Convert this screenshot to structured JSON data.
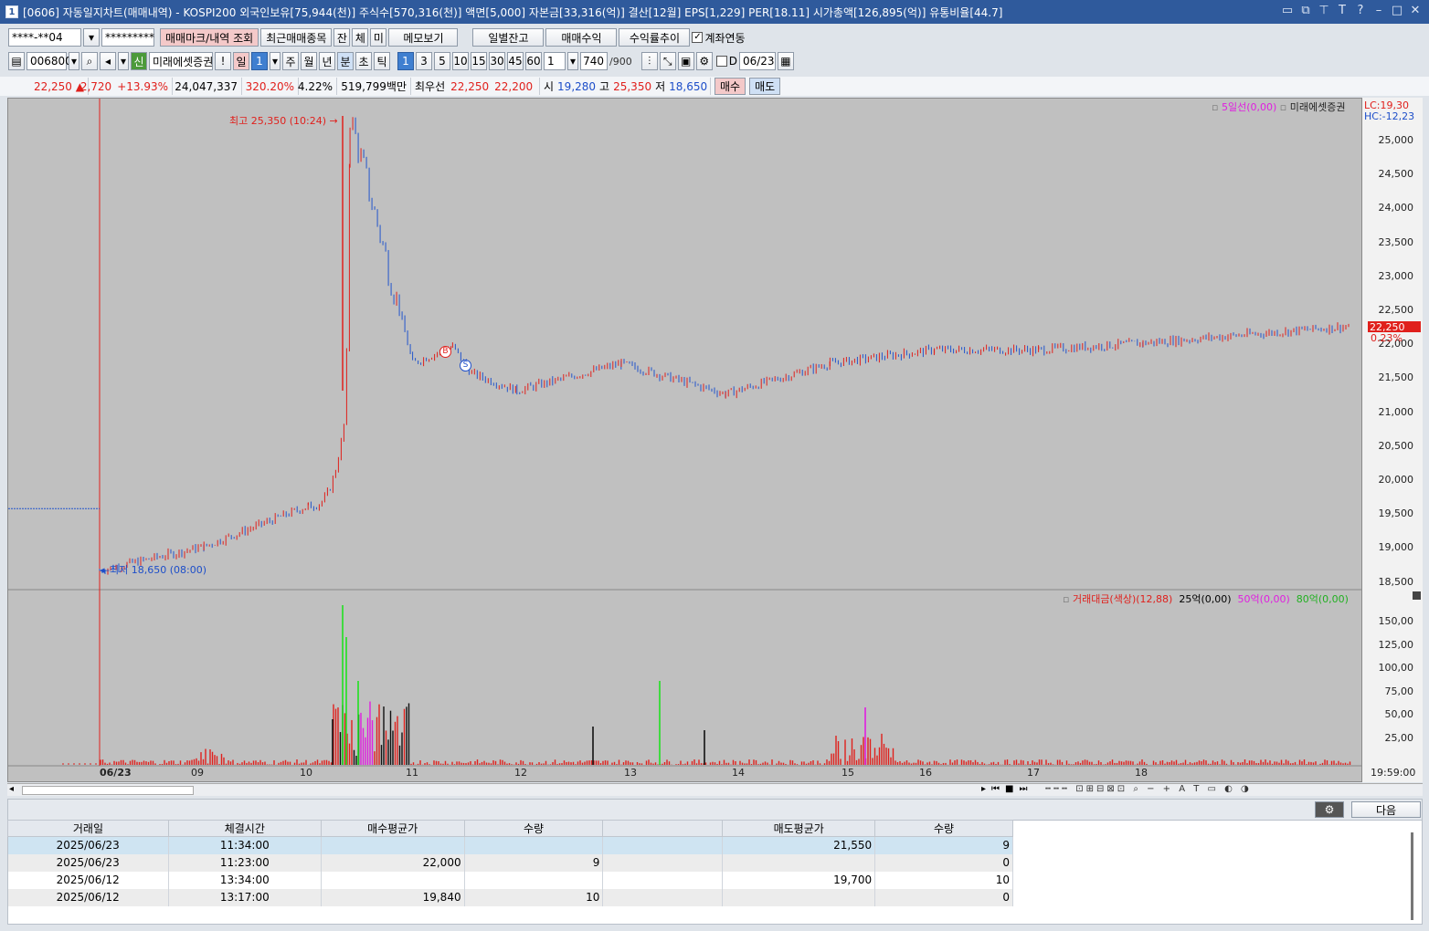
{
  "title": {
    "window_no": "1",
    "text": "[0606] 자동일지차트(매매내역) - KOSPI200 외국인보유[75,944(천)] 주식수[570,316(천)] 액면[5,000] 자본금[33,316(억)] 결산[12월] EPS[1,229] PER[18.11] 시가총액[126,895(억)] 유통비율[44.7]"
  },
  "toolbar1": {
    "account": "****-**04",
    "password": "*********",
    "mark_btn": "매매마크/내역 조회",
    "recent_btn": "최근매매종목",
    "tab_jan": "잔",
    "tab_che": "체",
    "tab_mi": "미",
    "memo_btn": "메모보기",
    "daily_btn": "일별잔고",
    "profit_btn": "매매수익",
    "yield_btn": "수익률추이",
    "link_check": "계좌연동"
  },
  "toolbar2": {
    "code": "006800",
    "badge": "신",
    "name": "미래에셋증권",
    "excl": "!",
    "periods": [
      "일",
      "1",
      "주",
      "월",
      "년",
      "분",
      "초",
      "틱"
    ],
    "minutes": [
      "1",
      "3",
      "5",
      "10",
      "15",
      "30",
      "45",
      "60"
    ],
    "unit": "1",
    "count": "740",
    "count_max": "/900",
    "d_label": "D",
    "date": "06/23"
  },
  "quote": {
    "price": "22,250",
    "arrow": "▲",
    "change": "2,720",
    "pct": "+13.93%",
    "volume": "24,047,337",
    "vol_ratio": "320.20%",
    "turnover": "4.22%",
    "amount": "519,799백만",
    "best_label": "최우선",
    "best_ask": "22,250",
    "best_bid": "22,200",
    "open_label": "시",
    "open": "19,280",
    "high_label": "고",
    "high": "25,350",
    "low_label": "저",
    "low": "18,650",
    "buy_btn": "매수",
    "sell_btn": "매도"
  },
  "chart": {
    "legend_ma": "5일선(0,00)",
    "legend_name": "미래에셋증권",
    "lc": "LC:19,30",
    "hc": "HC:-12,23",
    "high_note": "최고 25,350 (10:24)",
    "low_note": "최저 18,650 (08:00)",
    "price_tag": "22,250",
    "pct_tag": "0.23%",
    "buy_mark": "B",
    "sell_mark": "S",
    "yticks": [
      "25,000",
      "24,500",
      "24,000",
      "23,500",
      "23,000",
      "22,500",
      "22,000",
      "21,500",
      "21,000",
      "20,500",
      "20,000",
      "19,500",
      "19,000",
      "18,500"
    ],
    "vol_legend": {
      "name": "거래대금(색상)(12,88)",
      "l25": "25억(0,00)",
      "l50": "50억(0,00)",
      "l80": "80억(0,00)"
    },
    "vticks": [
      "150,00",
      "125,00",
      "100,00",
      "75,00",
      "50,00",
      "25,00"
    ],
    "xticks": [
      "06/23",
      "09",
      "10",
      "11",
      "12",
      "13",
      "14",
      "15",
      "16",
      "17",
      "18"
    ],
    "time": "19:59:00"
  },
  "chart_data": {
    "type": "line",
    "title": "",
    "ylim": [
      18500,
      25000
    ],
    "high": 25350,
    "low": 18650,
    "last": 22250,
    "x": [
      "08:00",
      "09:00",
      "10:00",
      "10:24",
      "11:00",
      "11:23",
      "11:34",
      "12:00",
      "13:00",
      "14:00",
      "15:00",
      "16:00",
      "17:00",
      "18:00",
      "19:59"
    ],
    "series": [
      {
        "name": "미래에셋증권",
        "values": [
          18650,
          19000,
          19600,
          25350,
          21700,
          21950,
          21550,
          21300,
          21700,
          21250,
          21700,
          21900,
          21900,
          22000,
          22250
        ]
      }
    ]
  },
  "next_btn": "다음",
  "table": {
    "headers": [
      "거래일",
      "체결시간",
      "매수평균가",
      "수량",
      "",
      "매도평균가",
      "수량"
    ],
    "rows": [
      [
        "2025/06/23",
        "11:34:00",
        "",
        "",
        "",
        "21,550",
        "9"
      ],
      [
        "2025/06/23",
        "11:23:00",
        "22,000",
        "9",
        "",
        "",
        "0"
      ],
      [
        "2025/06/12",
        "13:34:00",
        "",
        "",
        "",
        "19,700",
        "10"
      ],
      [
        "2025/06/12",
        "13:17:00",
        "19,840",
        "10",
        "",
        "",
        "0"
      ]
    ]
  }
}
